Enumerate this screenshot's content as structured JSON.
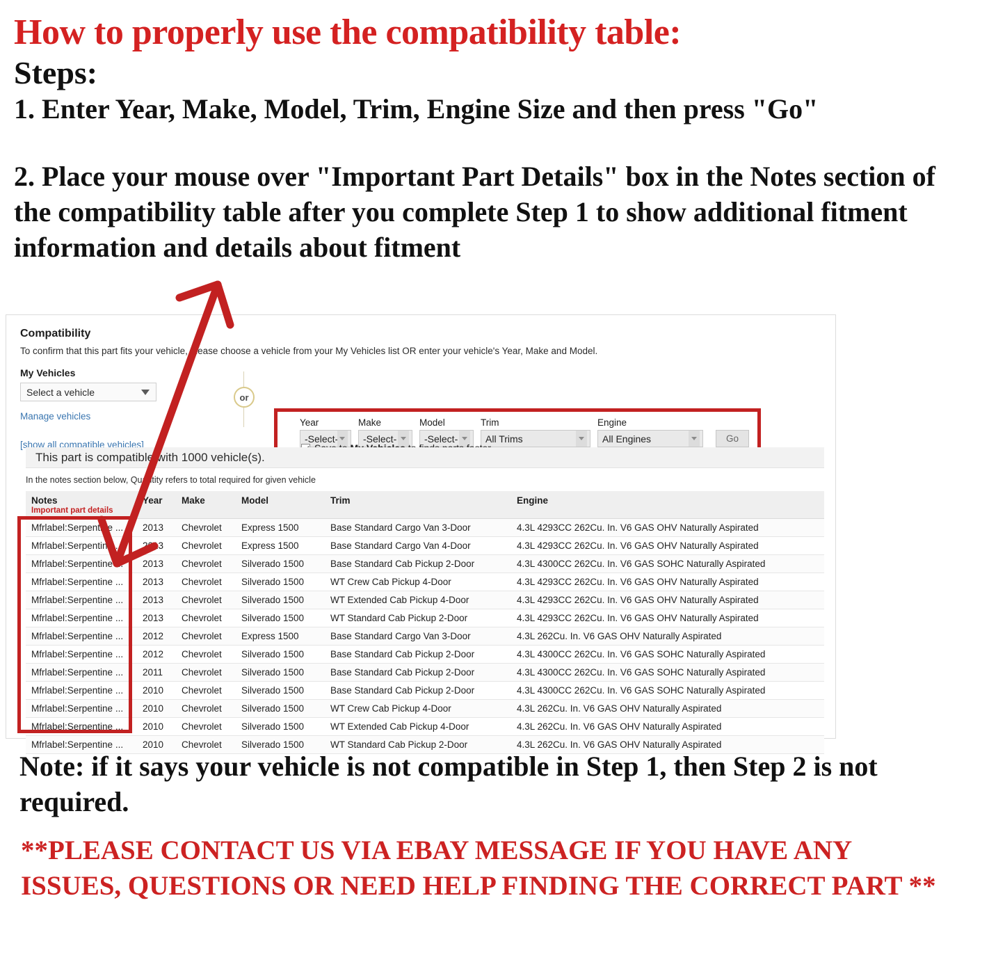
{
  "instructions": {
    "title": "How to properly use the compatibility table:",
    "steps_label": "Steps:",
    "step1": "1. Enter Year, Make, Model, Trim, Engine Size and then press \"Go\"",
    "step2": "2. Place your mouse over \"Important Part Details\" box in the Notes section of the compatibility table after you complete Step 1 to show additional fitment information and details about fitment",
    "note_bottom": "Note: if it says your vehicle is not compatible in Step 1, then Step 2 is not required.",
    "contact": "**PLEASE CONTACT US VIA EBAY MESSAGE IF YOU HAVE ANY ISSUES, QUESTIONS OR NEED HELP FINDING THE CORRECT PART **"
  },
  "compatibility": {
    "heading": "Compatibility",
    "subheading": "To confirm that this part fits your vehicle, please choose a vehicle from your My Vehicles list OR enter your vehicle's Year, Make and Model.",
    "my_vehicles_label": "My Vehicles",
    "my_vehicles_value": "Select a vehicle",
    "manage_vehicles_link": "Manage vehicles",
    "show_all_link": "[show all compatible vehicles]",
    "or_divider": "or",
    "banner": "This part is compatible with 1000 vehicle(s).",
    "notes_hint": "In the notes section below, Quantity refers to total required for given vehicle",
    "selectors": [
      {
        "label": "Year",
        "value": "-Select-",
        "width_class": "w-year"
      },
      {
        "label": "Make",
        "value": "-Select-",
        "width_class": "w-make"
      },
      {
        "label": "Model",
        "value": "-Select-",
        "width_class": "w-model"
      },
      {
        "label": "Trim",
        "value": "All Trims",
        "width_class": "w-trim"
      },
      {
        "label": "Engine",
        "value": "All Engines",
        "width_class": "w-engine"
      }
    ],
    "go_label": "Go",
    "save_checkbox": {
      "checked": true,
      "text_before": "Save to",
      "emphasis": "My Vehicles",
      "text_after": "to finds parts faster"
    },
    "table": {
      "headers": [
        "Notes",
        "Year",
        "Make",
        "Model",
        "Trim",
        "Engine"
      ],
      "notes_sub_header": "Important part details",
      "rows": [
        [
          "Mfrlabel:Serpentine ...",
          "2013",
          "Chevrolet",
          "Express 1500",
          "Base Standard Cargo Van 3-Door",
          "4.3L 4293CC 262Cu. In. V6 GAS OHV Naturally Aspirated"
        ],
        [
          "Mfrlabel:Serpentine ...",
          "2013",
          "Chevrolet",
          "Express 1500",
          "Base Standard Cargo Van 4-Door",
          "4.3L 4293CC 262Cu. In. V6 GAS OHV Naturally Aspirated"
        ],
        [
          "Mfrlabel:Serpentine ...",
          "2013",
          "Chevrolet",
          "Silverado 1500",
          "Base Standard Cab Pickup 2-Door",
          "4.3L 4300CC 262Cu. In. V6 GAS SOHC Naturally Aspirated"
        ],
        [
          "Mfrlabel:Serpentine ...",
          "2013",
          "Chevrolet",
          "Silverado 1500",
          "WT Crew Cab Pickup 4-Door",
          "4.3L 4293CC 262Cu. In. V6 GAS OHV Naturally Aspirated"
        ],
        [
          "Mfrlabel:Serpentine ...",
          "2013",
          "Chevrolet",
          "Silverado 1500",
          "WT Extended Cab Pickup 4-Door",
          "4.3L 4293CC 262Cu. In. V6 GAS OHV Naturally Aspirated"
        ],
        [
          "Mfrlabel:Serpentine ...",
          "2013",
          "Chevrolet",
          "Silverado 1500",
          "WT Standard Cab Pickup 2-Door",
          "4.3L 4293CC 262Cu. In. V6 GAS OHV Naturally Aspirated"
        ],
        [
          "Mfrlabel:Serpentine ...",
          "2012",
          "Chevrolet",
          "Express 1500",
          "Base Standard Cargo Van 3-Door",
          "4.3L 262Cu. In. V6 GAS OHV Naturally Aspirated"
        ],
        [
          "Mfrlabel:Serpentine ...",
          "2012",
          "Chevrolet",
          "Silverado 1500",
          "Base Standard Cab Pickup 2-Door",
          "4.3L 4300CC 262Cu. In. V6 GAS SOHC Naturally Aspirated"
        ],
        [
          "Mfrlabel:Serpentine ...",
          "2011",
          "Chevrolet",
          "Silverado 1500",
          "Base Standard Cab Pickup 2-Door",
          "4.3L 4300CC 262Cu. In. V6 GAS SOHC Naturally Aspirated"
        ],
        [
          "Mfrlabel:Serpentine ...",
          "2010",
          "Chevrolet",
          "Silverado 1500",
          "Base Standard Cab Pickup 2-Door",
          "4.3L 4300CC 262Cu. In. V6 GAS SOHC Naturally Aspirated"
        ],
        [
          "Mfrlabel:Serpentine ...",
          "2010",
          "Chevrolet",
          "Silverado 1500",
          "WT Crew Cab Pickup 4-Door",
          "4.3L 262Cu. In. V6 GAS OHV Naturally Aspirated"
        ],
        [
          "Mfrlabel:Serpentine ...",
          "2010",
          "Chevrolet",
          "Silverado 1500",
          "WT Extended Cab Pickup 4-Door",
          "4.3L 262Cu. In. V6 GAS OHV Naturally Aspirated"
        ],
        [
          "Mfrlabel:Serpentine ...",
          "2010",
          "Chevrolet",
          "Silverado 1500",
          "WT Standard Cab Pickup 2-Door",
          "4.3L 262Cu. In. V6 GAS OHV Naturally Aspirated"
        ]
      ]
    }
  },
  "colors": {
    "title_red": "#d42121",
    "annotation_red": "#c22121",
    "link_blue": "#3a76b0",
    "contact_red": "#cc2222"
  }
}
